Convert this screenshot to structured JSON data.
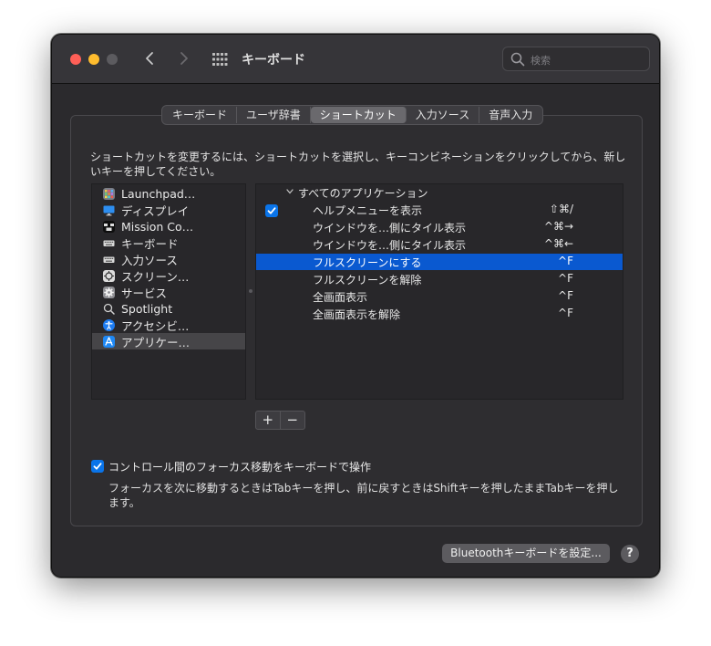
{
  "window": {
    "title": "キーボード",
    "search_placeholder": "検索",
    "colors": {
      "close": "#fe5f57",
      "minimize": "#febc2e",
      "zoom_inactive": "#5c5b5f",
      "accent": "#0a59d0"
    }
  },
  "tabs": [
    {
      "label": "キーボード",
      "active": false
    },
    {
      "label": "ユーザ辞書",
      "active": false
    },
    {
      "label": "ショートカット",
      "active": true
    },
    {
      "label": "入力ソース",
      "active": false
    },
    {
      "label": "音声入力",
      "active": false
    }
  ],
  "description": "ショートカットを変更するには、ショートカットを選択し、キーコンビネーションをクリックしてから、新しいキーを押してください。",
  "categories": [
    {
      "label": "Launchpad…",
      "icon": "launchpad-icon",
      "selected": false
    },
    {
      "label": "ディスプレイ",
      "icon": "display-icon",
      "selected": false
    },
    {
      "label": "Mission Co…",
      "icon": "mission-control-icon",
      "selected": false
    },
    {
      "label": "キーボード",
      "icon": "keyboard-icon",
      "selected": false
    },
    {
      "label": "入力ソース",
      "icon": "input-sources-icon",
      "selected": false
    },
    {
      "label": "スクリーン…",
      "icon": "screenshot-icon",
      "selected": false
    },
    {
      "label": "サービス",
      "icon": "services-gear-icon",
      "selected": false
    },
    {
      "label": "Spotlight",
      "icon": "spotlight-icon",
      "selected": false
    },
    {
      "label": "アクセシビ…",
      "icon": "accessibility-icon",
      "selected": false
    },
    {
      "label": "アプリケー…",
      "icon": "app-shortcuts-icon",
      "selected": true
    }
  ],
  "shortcuts": {
    "group_label": "すべてのアプリケーション",
    "rows": [
      {
        "label": "ヘルプメニューを表示",
        "key": "⇧⌘/",
        "checked": true,
        "selected": false
      },
      {
        "label": "ウインドウを…側にタイル表示",
        "key": "^⌘→",
        "checked": false,
        "selected": false
      },
      {
        "label": "ウインドウを…側にタイル表示",
        "key": "^⌘←",
        "checked": false,
        "selected": false
      },
      {
        "label": "フルスクリーンにする",
        "key": "^F",
        "checked": false,
        "selected": true
      },
      {
        "label": "フルスクリーンを解除",
        "key": "^F",
        "checked": false,
        "selected": false
      },
      {
        "label": "全画面表示",
        "key": "^F",
        "checked": false,
        "selected": false
      },
      {
        "label": "全画面表示を解除",
        "key": "^F",
        "checked": false,
        "selected": false
      }
    ]
  },
  "buttons": {
    "add": "+",
    "remove": "−",
    "bluetooth": "Bluetoothキーボードを設定...",
    "help": "?"
  },
  "keyboard_nav": {
    "checked": true,
    "label": "コントロール間のフォーカス移動をキーボードで操作",
    "description": "フォーカスを次に移動するときはTabキーを押し、前に戻すときはShiftキーを押したままTabキーを押します。"
  }
}
